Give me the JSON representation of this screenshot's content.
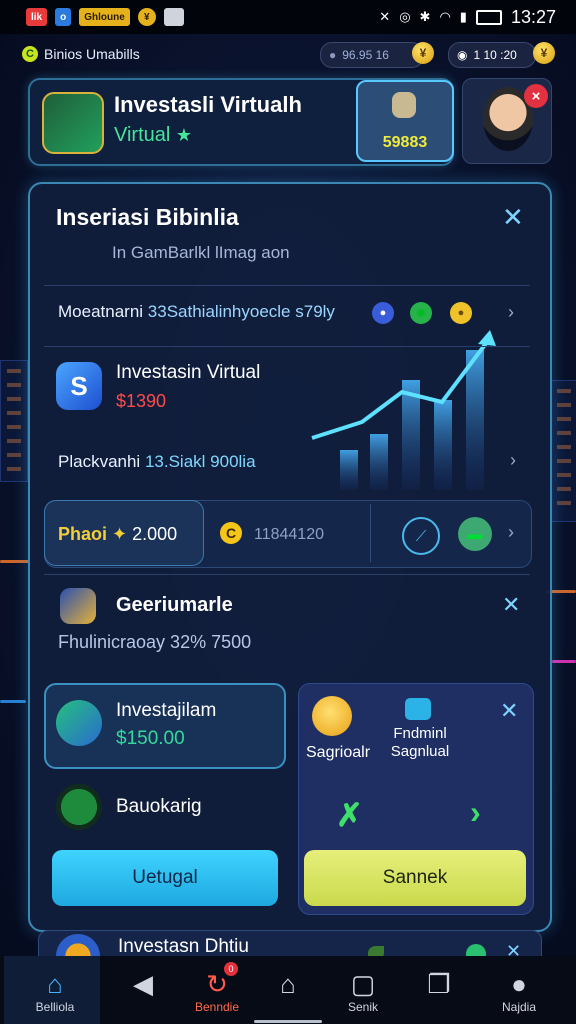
{
  "status_bar": {
    "left_chips": [
      "lik",
      "o",
      "Ghloune",
      "¥"
    ],
    "time": "13:27"
  },
  "app_bar": {
    "app_name": "Binios Umabills",
    "balance_1": "96.95 16",
    "balance_2": "1 10 :20",
    "coin_symbol": "¥"
  },
  "header": {
    "title": "Investasli Virtualh",
    "subtitle": "Virtual",
    "star": "★",
    "box_value": "59883"
  },
  "panel": {
    "title": "Inseriasi Bibinlia",
    "subtitle": "In GamBarlkl lImag aon",
    "row1": {
      "label": "Moeatnarni",
      "value": "33Sathialinhyoecle s79ly"
    },
    "row2": {
      "title": "Investasin Virtual",
      "amount": "$1390"
    },
    "row3": {
      "label": "Plackvanhi",
      "value": "13.Siakl 900lia"
    },
    "tabs": {
      "tab_a_label": "Phaoi",
      "tab_a_value": "2.000",
      "tab_b_label": "11844120"
    },
    "row4": {
      "title": "Geeriumarle",
      "subtitle": "Fhulinicraoay 32% 7500"
    },
    "card_left": {
      "title": "Investajilam",
      "amount": "$150.00",
      "second_title": "Bauokarig",
      "button": "Uetugal"
    },
    "card_right": {
      "item_a": "Sagrioalr",
      "item_b": "Fndminl Sagnlual",
      "button": "Sannek"
    }
  },
  "peek_card": {
    "title": "Investasn Dhtiu"
  },
  "bottom_nav": [
    {
      "label": "Belliola",
      "icon": "home-icon"
    },
    {
      "label": "",
      "icon": "back-icon"
    },
    {
      "label": "Benndie",
      "icon": "refresh-icon",
      "badge": "0"
    },
    {
      "label": "",
      "icon": "home-outline-icon"
    },
    {
      "label": "Senik",
      "icon": "square-icon"
    },
    {
      "label": "",
      "icon": "recent-apps-icon"
    },
    {
      "label": "Najdia",
      "icon": "profile-icon"
    }
  ],
  "colors": {
    "accent_cyan": "#3fd3ff",
    "accent_yellow": "#e6ef7a",
    "amount_red": "#ff4a4a",
    "amount_green": "#34d89b"
  }
}
